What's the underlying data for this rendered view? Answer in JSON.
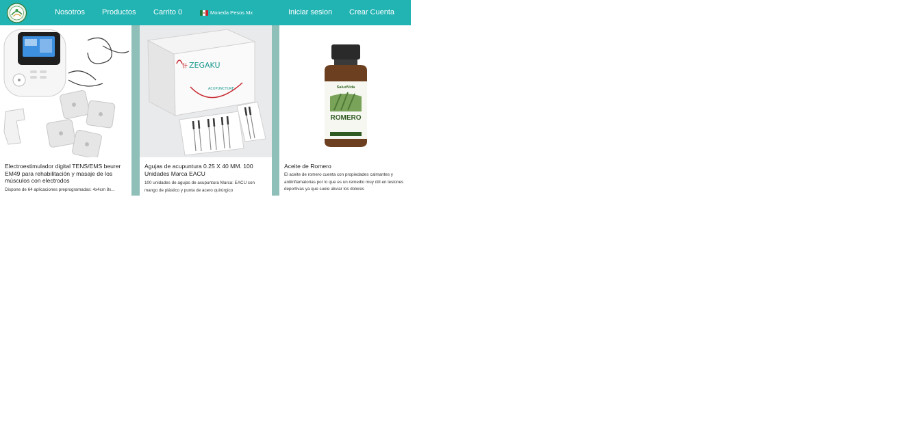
{
  "nav": {
    "logo_alt": "Salud Vida logo",
    "links": [
      "Nosotros",
      "Productos",
      "Carrito 0"
    ],
    "currency_label": "Moneda Pesos Mx",
    "currency_flag": "mexico-flag-icon",
    "login_label": "Iniciar sesion",
    "register_label": "Crear Cuenta"
  },
  "products": [
    {
      "title": "Electroestimulador digital TENS/EMS beurer EM49 para rehabilitación y masaje de los músculos con electrodos",
      "description": "Dispone de 64 aplicaciones preprogramadas: 4x4cm 8x...",
      "image": "tens-device-image"
    },
    {
      "title": "Agujas de acupuntura 0.25 X 40 MM. 100 Unidades Marca EACU",
      "description": "100 unidades de agujas de acupuntura Marca: EACU con mango de plástico y punta de acero quirúrgico",
      "image": "acupuncture-needles-image"
    },
    {
      "title": "Aceite de Romero",
      "description": "El aceite de romero cuenta con propiedades calmantes y antiinflamatorias por lo que es un remedio muy útil en lesiones deportivas ya que suele aliviar los dolores",
      "image": "rosemary-oil-image",
      "label_brand": "SaludVida",
      "label_product": "ROMERO"
    }
  ],
  "colors": {
    "navbar": "#22b3b3",
    "column_band": "#8fbfb9",
    "text": "#222222"
  }
}
